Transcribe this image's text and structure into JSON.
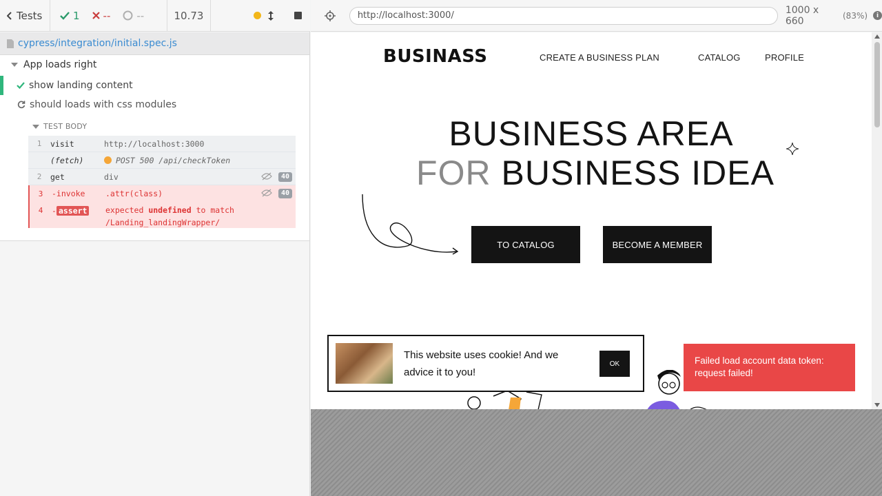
{
  "reporter": {
    "tests_label": "Tests",
    "passed_count": "1",
    "failed_count": "--",
    "pending_count": "--",
    "duration": "10.73",
    "spec_file": "cypress/integration/initial.spec.js",
    "suite_title": "App loads right",
    "tests": [
      {
        "title": "show landing content",
        "state": "passed"
      },
      {
        "title": "should loads with css modules",
        "state": "running"
      }
    ],
    "test_body_label": "TEST BODY",
    "commands": [
      {
        "num": "1",
        "name": "visit",
        "message": "http://localhost:3000"
      },
      {
        "num": "",
        "name": "(fetch)",
        "message": "POST 500 /api/checkToken"
      },
      {
        "num": "2",
        "name": "get",
        "message": "div",
        "badge": "40"
      },
      {
        "num": "3",
        "name": "-invoke",
        "message": ".attr(class)",
        "badge": "40"
      },
      {
        "num": "4",
        "name_prefix": "-",
        "name": "assert",
        "message_a": "expected",
        "message_b": "undefined",
        "message_c": "to match",
        "message_d": "/Landing_landingWrapper/"
      }
    ]
  },
  "aut": {
    "url": "http://localhost:3000/",
    "viewport": "1000 x 660",
    "scale": "(83%)",
    "site": {
      "logo": "BUSINASS",
      "nav": [
        "CREATE A BUSINESS PLAN",
        "CATALOG",
        "PROFILE"
      ],
      "hero_line1": "BUSINESS AREA",
      "hero_line2_muted": "FOR",
      "hero_line2": "BUSINESS IDEA",
      "btn_catalog": "TO CATALOG",
      "btn_member": "BECOME A MEMBER",
      "cookie_text": "This website uses cookie! And we advice it to you!",
      "cookie_ok": "OK",
      "toast": "Failed load account data token: request failed!"
    }
  },
  "colors": {
    "pass": "#2fb67c",
    "fail": "#e25555",
    "toast": "#e94747",
    "link": "#3a8bd1"
  }
}
